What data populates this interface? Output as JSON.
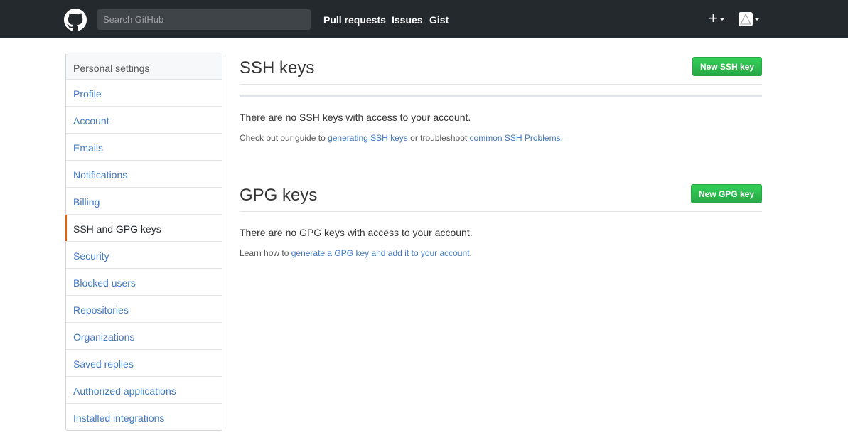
{
  "header": {
    "search_placeholder": "Search GitHub",
    "nav": [
      "Pull requests",
      "Issues",
      "Gist"
    ],
    "plus": "+",
    "logo_icon": "github-octocat-icon",
    "avatar_icon": "user-avatar-icon"
  },
  "sidebar": {
    "heading": "Personal settings",
    "items": [
      {
        "label": "Profile"
      },
      {
        "label": "Account"
      },
      {
        "label": "Emails"
      },
      {
        "label": "Notifications"
      },
      {
        "label": "Billing"
      },
      {
        "label": "SSH and GPG keys",
        "active": true
      },
      {
        "label": "Security"
      },
      {
        "label": "Blocked users"
      },
      {
        "label": "Repositories"
      },
      {
        "label": "Organizations"
      },
      {
        "label": "Saved replies"
      },
      {
        "label": "Authorized applications"
      },
      {
        "label": "Installed integrations"
      }
    ]
  },
  "ssh": {
    "title": "SSH keys",
    "button": "New SSH key",
    "empty_message": "There are no SSH keys with access to your account.",
    "note_prefix": "Check out our guide to ",
    "note_link1": "generating SSH keys",
    "note_middle": " or troubleshoot ",
    "note_link2": "common SSH Problems",
    "note_suffix": "."
  },
  "gpg": {
    "title": "GPG keys",
    "button": "New GPG key",
    "empty_message": "There are no GPG keys with access to your account.",
    "note_prefix": "Learn how to ",
    "note_link": "generate a GPG key and add it to your account",
    "note_suffix": "."
  },
  "colors": {
    "header_bg": "#24292e",
    "link": "#4078c0",
    "button_green": "#28a745",
    "active_marker": "#e36209"
  }
}
